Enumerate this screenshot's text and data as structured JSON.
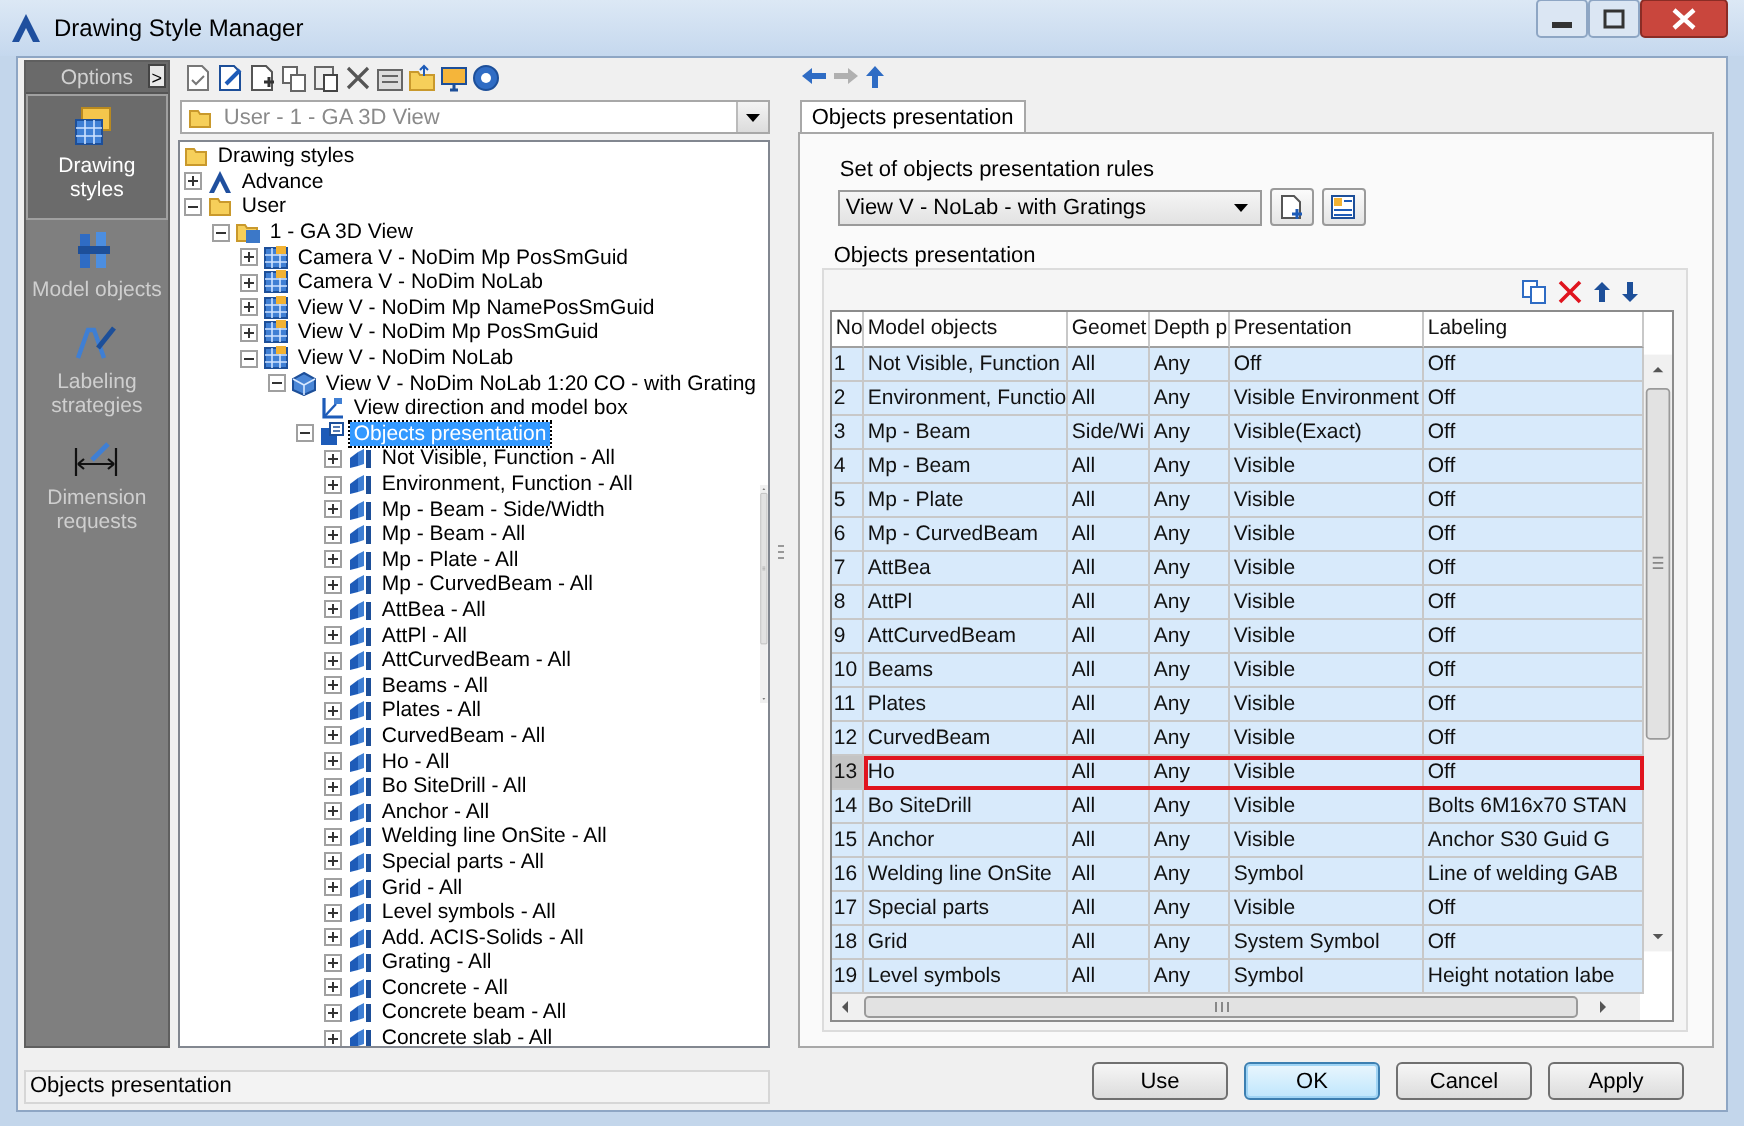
{
  "window": {
    "title": "Drawing Style Manager"
  },
  "sidebar": {
    "header": "Options",
    "toggle": ">",
    "items": [
      {
        "label": "Drawing styles",
        "kind": "styles",
        "selected": true
      },
      {
        "label": "Model objects",
        "kind": "objects",
        "selected": false
      },
      {
        "label": "Labeling strategies",
        "kind": "labeling",
        "selected": false
      },
      {
        "label": "Dimension requests",
        "kind": "dimension",
        "selected": false
      }
    ]
  },
  "style_picker": {
    "value": "User - 1 - GA 3D View"
  },
  "tree": [
    {
      "label": "Drawing styles",
      "kind": "folder",
      "selected": false,
      "children": [
        {
          "label": "Advance",
          "kind": "product",
          "expanded": false,
          "selected": false
        },
        {
          "label": "User",
          "kind": "folder",
          "expanded": true,
          "selected": false,
          "children": [
            {
              "label": "1 - GA 3D View",
              "kind": "group",
              "expanded": true,
              "selected": false,
              "children": [
                {
                  "label": "Camera V - NoDim Mp PosSmGuid",
                  "kind": "style",
                  "expanded": false,
                  "selected": false
                },
                {
                  "label": "Camera V - NoDim NoLab",
                  "kind": "style",
                  "expanded": false,
                  "selected": false
                },
                {
                  "label": "View V - NoDim Mp NamePosSmGuid",
                  "kind": "style",
                  "expanded": false,
                  "selected": false
                },
                {
                  "label": "View V - NoDim Mp PosSmGuid",
                  "kind": "style",
                  "expanded": false,
                  "selected": false
                },
                {
                  "label": "View V - NoDim NoLab",
                  "kind": "style",
                  "expanded": true,
                  "selected": false,
                  "children": [
                    {
                      "label": "View V - NoDim NoLab 1:20 CO - with Grating",
                      "kind": "view",
                      "expanded": true,
                      "selected": false,
                      "children": [
                        {
                          "label": "View direction and model box",
                          "kind": "direction",
                          "selected": false
                        },
                        {
                          "label": "Objects presentation",
                          "kind": "presentation",
                          "expanded": true,
                          "selected": true,
                          "children": [
                            {
                              "label": "Not Visible, Function - All",
                              "kind": "rule",
                              "expanded": false,
                              "selected": false
                            },
                            {
                              "label": "Environment, Function - All",
                              "kind": "rule",
                              "expanded": false,
                              "selected": false
                            },
                            {
                              "label": "Mp - Beam - Side/Width",
                              "kind": "rule",
                              "expanded": false,
                              "selected": false
                            },
                            {
                              "label": "Mp - Beam - All",
                              "kind": "rule",
                              "expanded": false,
                              "selected": false
                            },
                            {
                              "label": "Mp - Plate - All",
                              "kind": "rule",
                              "expanded": false,
                              "selected": false
                            },
                            {
                              "label": "Mp - CurvedBeam - All",
                              "kind": "rule",
                              "expanded": false,
                              "selected": false
                            },
                            {
                              "label": "AttBea - All",
                              "kind": "rule",
                              "expanded": false,
                              "selected": false
                            },
                            {
                              "label": "AttPl - All",
                              "kind": "rule",
                              "expanded": false,
                              "selected": false
                            },
                            {
                              "label": "AttCurvedBeam - All",
                              "kind": "rule",
                              "expanded": false,
                              "selected": false
                            },
                            {
                              "label": "Beams - All",
                              "kind": "rule",
                              "expanded": false,
                              "selected": false
                            },
                            {
                              "label": "Plates - All",
                              "kind": "rule",
                              "expanded": false,
                              "selected": false
                            },
                            {
                              "label": "CurvedBeam - All",
                              "kind": "rule",
                              "expanded": false,
                              "selected": false
                            },
                            {
                              "label": "Ho - All",
                              "kind": "rule",
                              "expanded": false,
                              "selected": false
                            },
                            {
                              "label": "Bo SiteDrill - All",
                              "kind": "rule",
                              "expanded": false,
                              "selected": false
                            },
                            {
                              "label": "Anchor - All",
                              "kind": "rule",
                              "expanded": false,
                              "selected": false
                            },
                            {
                              "label": "Welding line OnSite - All",
                              "kind": "rule",
                              "expanded": false,
                              "selected": false
                            },
                            {
                              "label": "Special parts - All",
                              "kind": "rule",
                              "expanded": false,
                              "selected": false
                            },
                            {
                              "label": "Grid - All",
                              "kind": "rule",
                              "expanded": false,
                              "selected": false
                            },
                            {
                              "label": "Level symbols - All",
                              "kind": "rule",
                              "expanded": false,
                              "selected": false
                            },
                            {
                              "label": "Add. ACIS-Solids - All",
                              "kind": "rule",
                              "expanded": false,
                              "selected": false
                            },
                            {
                              "label": "Grating - All",
                              "kind": "rule",
                              "expanded": false,
                              "selected": false
                            },
                            {
                              "label": "Concrete - All",
                              "kind": "rule",
                              "expanded": false,
                              "selected": false
                            },
                            {
                              "label": "Concrete beam - All",
                              "kind": "rule",
                              "expanded": false,
                              "selected": false
                            },
                            {
                              "label": "Concrete slab - All",
                              "kind": "rule",
                              "expanded": false,
                              "selected": false
                            }
                          ]
                        }
                      ]
                    }
                  ]
                }
              ]
            }
          ]
        }
      ]
    }
  ],
  "tabs": [
    {
      "label": "Objects presentation",
      "selected": true
    }
  ],
  "rule_set": {
    "label": "Set of objects presentation rules",
    "value": "View V - NoLab - with Gratings"
  },
  "presentation": {
    "title": "Objects presentation",
    "columns": [
      "No",
      "Model objects",
      "Geomet",
      "Depth p",
      "Presentation",
      "Labeling"
    ],
    "rows": [
      {
        "no": "1",
        "model": "Not Visible, Function",
        "geometry": "All",
        "depth": "Any",
        "presentation": "Off",
        "labeling": "Off",
        "current": false
      },
      {
        "no": "2",
        "model": "Environment, Functio",
        "geometry": "All",
        "depth": "Any",
        "presentation": "Visible Environment",
        "labeling": "Off",
        "current": false
      },
      {
        "no": "3",
        "model": "Mp - Beam",
        "geometry": "Side/Wi",
        "depth": "Any",
        "presentation": "Visible(Exact)",
        "labeling": "Off",
        "current": false
      },
      {
        "no": "4",
        "model": "Mp - Beam",
        "geometry": "All",
        "depth": "Any",
        "presentation": "Visible",
        "labeling": "Off",
        "current": false
      },
      {
        "no": "5",
        "model": "Mp - Plate",
        "geometry": "All",
        "depth": "Any",
        "presentation": "Visible",
        "labeling": "Off",
        "current": false
      },
      {
        "no": "6",
        "model": "Mp - CurvedBeam",
        "geometry": "All",
        "depth": "Any",
        "presentation": "Visible",
        "labeling": "Off",
        "current": false
      },
      {
        "no": "7",
        "model": "AttBea",
        "geometry": "All",
        "depth": "Any",
        "presentation": "Visible",
        "labeling": "Off",
        "current": false
      },
      {
        "no": "8",
        "model": "AttPl",
        "geometry": "All",
        "depth": "Any",
        "presentation": "Visible",
        "labeling": "Off",
        "current": false
      },
      {
        "no": "9",
        "model": "AttCurvedBeam",
        "geometry": "All",
        "depth": "Any",
        "presentation": "Visible",
        "labeling": "Off",
        "current": false
      },
      {
        "no": "10",
        "model": "Beams",
        "geometry": "All",
        "depth": "Any",
        "presentation": "Visible",
        "labeling": "Off",
        "current": false
      },
      {
        "no": "11",
        "model": "Plates",
        "geometry": "All",
        "depth": "Any",
        "presentation": "Visible",
        "labeling": "Off",
        "current": false
      },
      {
        "no": "12",
        "model": "CurvedBeam",
        "geometry": "All",
        "depth": "Any",
        "presentation": "Visible",
        "labeling": "Off",
        "current": false
      },
      {
        "no": "13",
        "model": "Ho",
        "geometry": "All",
        "depth": "Any",
        "presentation": "Visible",
        "labeling": "Off",
        "current": true
      },
      {
        "no": "14",
        "model": "Bo SiteDrill",
        "geometry": "All",
        "depth": "Any",
        "presentation": "Visible",
        "labeling": "Bolts 6M16x70 STAN",
        "current": false
      },
      {
        "no": "15",
        "model": "Anchor",
        "geometry": "All",
        "depth": "Any",
        "presentation": "Visible",
        "labeling": "Anchor S30 Guid G",
        "current": false
      },
      {
        "no": "16",
        "model": "Welding line OnSite",
        "geometry": "All",
        "depth": "Any",
        "presentation": "Symbol",
        "labeling": "Line of welding GAB",
        "current": false
      },
      {
        "no": "17",
        "model": "Special parts",
        "geometry": "All",
        "depth": "Any",
        "presentation": "Visible",
        "labeling": "Off",
        "current": false
      },
      {
        "no": "18",
        "model": "Grid",
        "geometry": "All",
        "depth": "Any",
        "presentation": "System Symbol",
        "labeling": "Off",
        "current": false
      },
      {
        "no": "19",
        "model": "Level symbols",
        "geometry": "All",
        "depth": "Any",
        "presentation": "Symbol",
        "labeling": "Height notation labe",
        "current": false
      }
    ]
  },
  "status_bar": "Objects presentation",
  "buttons": [
    {
      "label": "Use",
      "default": false
    },
    {
      "label": "OK",
      "default": true
    },
    {
      "label": "Cancel",
      "default": false
    },
    {
      "label": "Apply",
      "default": false
    }
  ]
}
